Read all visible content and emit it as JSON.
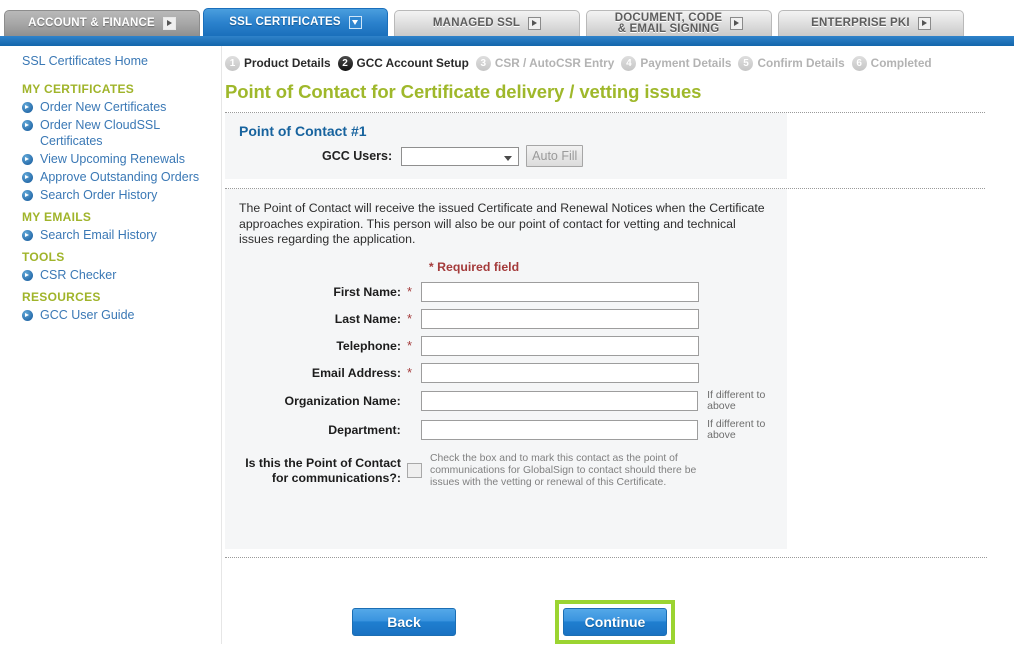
{
  "tabs": [
    {
      "label": "ACCOUNT & FINANCE",
      "state": "inactive-dark",
      "icon": "chevron-right-box-icon"
    },
    {
      "label": "SSL CERTIFICATES",
      "state": "active",
      "icon": "chevron-down-box-icon"
    },
    {
      "label": "MANAGED SSL",
      "state": "inactive",
      "icon": "chevron-right-box-icon"
    },
    {
      "label": "DOCUMENT, CODE\n& EMAIL SIGNING",
      "state": "inactive",
      "icon": "chevron-right-box-icon"
    },
    {
      "label": "ENTERPRISE PKI",
      "state": "inactive",
      "icon": "chevron-right-box-icon"
    }
  ],
  "sidebar": {
    "home_label": "SSL Certificates Home",
    "groups": [
      {
        "title": "MY CERTIFICATES",
        "items": [
          {
            "label": "Order New Certificates"
          },
          {
            "label": "Order New CloudSSL Certificates"
          },
          {
            "label": "View Upcoming Renewals"
          },
          {
            "label": "Approve Outstanding Orders"
          },
          {
            "label": "Search Order History"
          }
        ]
      },
      {
        "title": "MY EMAILS",
        "items": [
          {
            "label": "Search Email History"
          }
        ]
      },
      {
        "title": "TOOLS",
        "items": [
          {
            "label": "CSR Checker"
          }
        ]
      },
      {
        "title": "RESOURCES",
        "items": [
          {
            "label": "GCC User Guide"
          }
        ]
      }
    ]
  },
  "steps": [
    {
      "num": "1",
      "label": "Product Details",
      "state": "done"
    },
    {
      "num": "2",
      "label": "GCC Account Setup",
      "state": "current"
    },
    {
      "num": "3",
      "label": "CSR / AutoCSR Entry",
      "state": "todo"
    },
    {
      "num": "4",
      "label": "Payment Details",
      "state": "todo"
    },
    {
      "num": "5",
      "label": "Confirm Details",
      "state": "todo"
    },
    {
      "num": "6",
      "label": "Completed",
      "state": "todo"
    }
  ],
  "page": {
    "title": "Point of Contact for Certificate delivery / vetting issues"
  },
  "contact_panel": {
    "title": "Point of Contact #1",
    "gcc_users_label": "GCC Users:",
    "gcc_users_value": "",
    "auto_fill_label": "Auto Fill"
  },
  "form": {
    "intro": "The Point of Contact will receive the issued Certificate and Renewal Notices when the Certificate approaches expiration. This person will also be our point of contact for vetting and technical issues regarding the application.",
    "required_note": "Required field",
    "required_star": "*",
    "fields": [
      {
        "label": "First Name:",
        "required": true,
        "value": "",
        "hint": ""
      },
      {
        "label": "Last Name:",
        "required": true,
        "value": "",
        "hint": ""
      },
      {
        "label": "Telephone:",
        "required": true,
        "value": "",
        "hint": ""
      },
      {
        "label": "Email Address:",
        "required": true,
        "value": "",
        "hint": ""
      },
      {
        "label": "Organization Name:",
        "required": false,
        "value": "",
        "hint": "If different to above"
      },
      {
        "label": "Department:",
        "required": false,
        "value": "",
        "hint": "If different to above"
      }
    ],
    "checkbox": {
      "label": "Is this the Point of Contact for communications?:",
      "checked": false,
      "hint": "Check the box and to mark this contact as the point of communications for GlobalSign to contact should there be issues with the vetting or renewal of this Certificate."
    }
  },
  "actions": {
    "back_label": "Back",
    "continue_label": "Continue",
    "continue_highlight_color": "#9bd431"
  }
}
